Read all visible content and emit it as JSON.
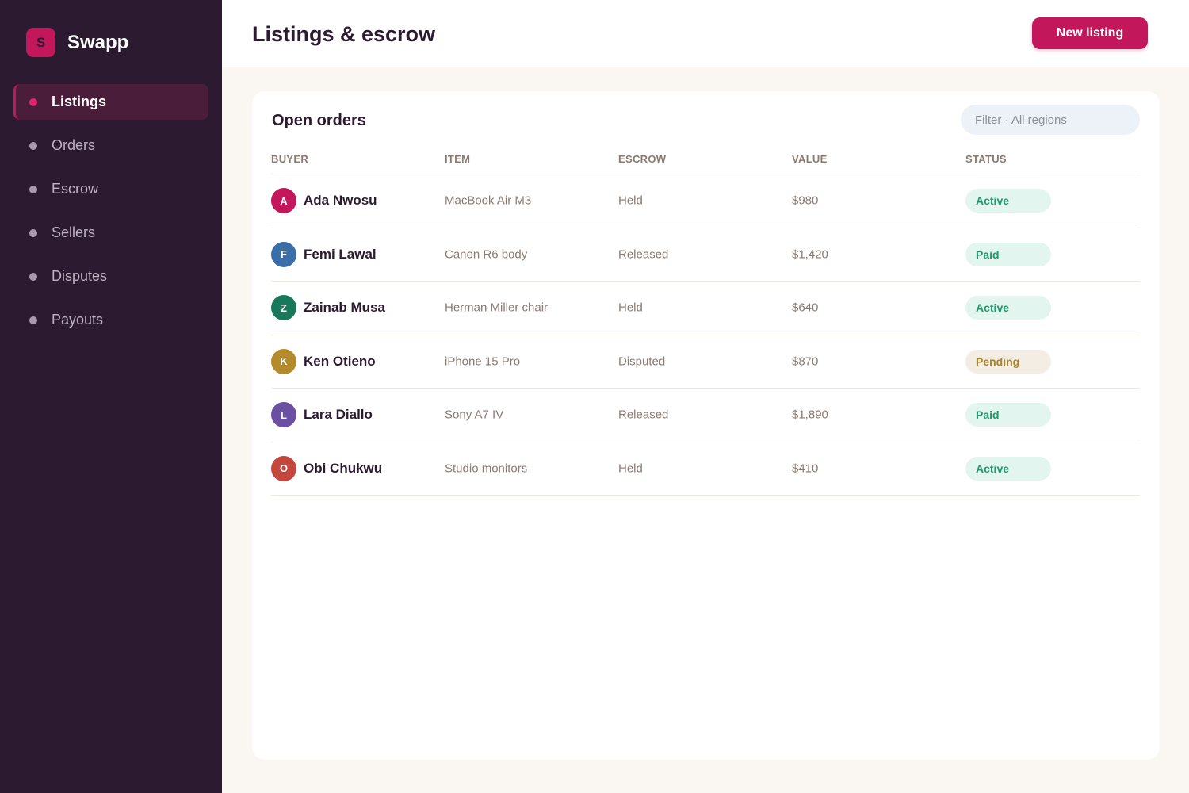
{
  "app": {
    "logo_letter": "S",
    "name": "Swapp"
  },
  "sidebar": {
    "items": [
      {
        "label": "Listings",
        "active": true
      },
      {
        "label": "Orders",
        "active": false
      },
      {
        "label": "Escrow",
        "active": false
      },
      {
        "label": "Sellers",
        "active": false
      },
      {
        "label": "Disputes",
        "active": false
      },
      {
        "label": "Payouts",
        "active": false
      }
    ]
  },
  "header": {
    "title": "Listings & escrow",
    "new_button": "New listing"
  },
  "card": {
    "title": "Open orders",
    "filter": "Filter · All regions",
    "columns": [
      "BUYER",
      "ITEM",
      "ESCROW",
      "VALUE",
      "STATUS"
    ],
    "rows": [
      {
        "initial": "A",
        "buyer": "Ada Nwosu",
        "item": "MacBook Air M3",
        "escrow": "Held",
        "value": "$980",
        "status": "Active",
        "avatar_color": "#c2185b"
      },
      {
        "initial": "F",
        "buyer": "Femi Lawal",
        "item": "Canon R6 body",
        "escrow": "Released",
        "value": "$1,420",
        "status": "Paid",
        "avatar_color": "#3a6ea8"
      },
      {
        "initial": "Z",
        "buyer": "Zainab Musa",
        "item": "Herman Miller chair",
        "escrow": "Held",
        "value": "$640",
        "status": "Active",
        "avatar_color": "#17785a"
      },
      {
        "initial": "K",
        "buyer": "Ken Otieno",
        "item": "iPhone 15 Pro",
        "escrow": "Disputed",
        "value": "$870",
        "status": "Pending",
        "avatar_color": "#b58a2c"
      },
      {
        "initial": "L",
        "buyer": "Lara Diallo",
        "item": "Sony A7 IV",
        "escrow": "Released",
        "value": "$1,890",
        "status": "Paid",
        "avatar_color": "#6a4fa3"
      },
      {
        "initial": "O",
        "buyer": "Obi Chukwu",
        "item": "Studio monitors",
        "escrow": "Held",
        "value": "$410",
        "status": "Active",
        "avatar_color": "#c4473d"
      }
    ]
  },
  "status_colors": {
    "Active": {
      "bg": "#e2f5ee",
      "fg": "#1f9a6c"
    },
    "Paid": {
      "bg": "#e2f5ee",
      "fg": "#1f9a6c"
    },
    "Pending": {
      "bg": "#f4ede4",
      "fg": "#a8822c"
    }
  },
  "colors": {
    "accent": "#c2185b",
    "sidebar_bg": "#2b1a30"
  }
}
